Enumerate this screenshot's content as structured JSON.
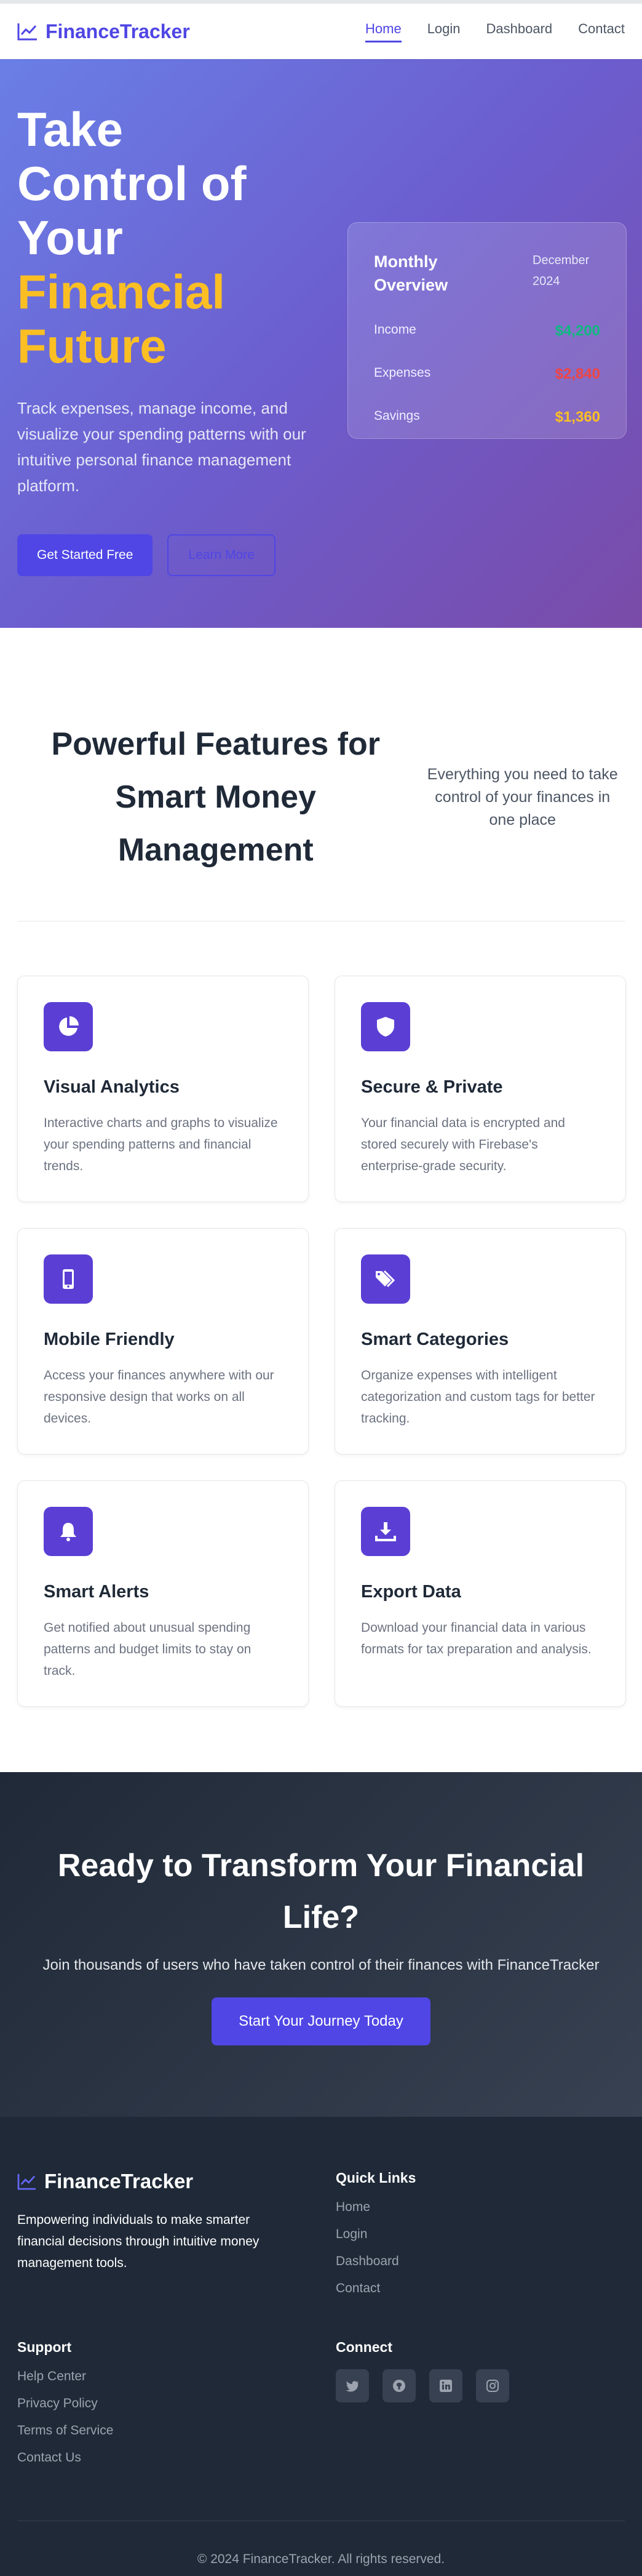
{
  "nav": {
    "brand": "FinanceTracker",
    "links": [
      {
        "label": "Home"
      },
      {
        "label": "Login"
      },
      {
        "label": "Dashboard"
      },
      {
        "label": "Contact"
      }
    ]
  },
  "hero": {
    "title_line1": "Take",
    "title_line2": "Control of",
    "title_line3": "Your",
    "title_accent1": "Financial",
    "title_accent2": "Future",
    "subtitle": "Track expenses, manage income, and visualize your spending patterns with our intuitive personal finance management platform.",
    "primary_button": "Get Started Free",
    "secondary_button": "Learn More",
    "overview": {
      "title": "Monthly Overview",
      "date": "December 2024",
      "income_label": "Income",
      "income_value": "$4,200",
      "expenses_label": "Expenses",
      "expenses_value": "$2,840",
      "savings_label": "Savings",
      "savings_value": "$1,360"
    }
  },
  "features": {
    "title": "Powerful Features for Smart Money Management",
    "subtitle": "Everything you need to take control of your finances in one place",
    "cards": [
      {
        "title": "Visual Analytics",
        "description": "Interactive charts and graphs to visualize your spending patterns and financial trends.",
        "icon": "pie-chart-icon"
      },
      {
        "title": "Secure & Private",
        "description": "Your financial data is encrypted and stored securely with Firebase's enterprise-grade security.",
        "icon": "shield-icon"
      },
      {
        "title": "Mobile Friendly",
        "description": "Access your finances anywhere with our responsive design that works on all devices.",
        "icon": "mobile-icon"
      },
      {
        "title": "Smart Categories",
        "description": "Organize expenses with intelligent categorization and custom tags for better tracking.",
        "icon": "tags-icon"
      },
      {
        "title": "Smart Alerts",
        "description": "Get notified about unusual spending patterns and budget limits to stay on track.",
        "icon": "bell-icon"
      },
      {
        "title": "Export Data",
        "description": "Download your financial data in various formats for tax preparation and analysis.",
        "icon": "download-icon"
      }
    ]
  },
  "cta": {
    "title": "Ready to Transform Your Financial Life?",
    "subtitle": "Join thousands of users who have taken control of their finances with FinanceTracker",
    "button": "Start Your Journey Today"
  },
  "footer": {
    "brand": "FinanceTracker",
    "description": "Empowering individuals to make smarter financial decisions through intuitive money management tools.",
    "quick_links_title": "Quick Links",
    "quick_links": [
      "Home",
      "Login",
      "Dashboard",
      "Contact"
    ],
    "support_title": "Support",
    "support_links": [
      "Help Center",
      "Privacy Policy",
      "Terms of Service",
      "Contact Us"
    ],
    "connect_title": "Connect",
    "social": [
      "twitter-icon",
      "github-icon",
      "linkedin-icon",
      "instagram-icon"
    ],
    "copyright": "© 2024 FinanceTracker. All rights reserved."
  },
  "colors": {
    "brand": "#4f46e5",
    "accent": "#fbbf24",
    "income": "#10b981",
    "expense": "#ef4444"
  }
}
